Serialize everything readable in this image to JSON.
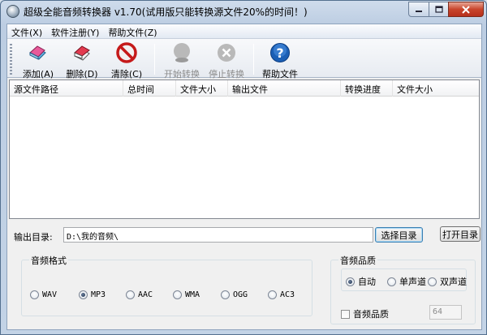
{
  "window": {
    "title": "超级全能音频转换器 v1.70(试用版只能转换源文件20%的时间！)",
    "minimize_icon": "minimize-icon",
    "maximize_icon": "maximize-icon",
    "close_icon": "close-icon"
  },
  "menu": {
    "items": [
      {
        "label": "文件(X)"
      },
      {
        "label": "软件注册(Y)"
      },
      {
        "label": "帮助文件(Z)"
      }
    ]
  },
  "toolbar": {
    "buttons": [
      {
        "label": "添加(A)",
        "icon": "add-files-icon",
        "enabled": true
      },
      {
        "label": "删除(D)",
        "icon": "delete-eraser-icon",
        "enabled": true
      },
      {
        "label": "清除(C)",
        "icon": "clear-forbidden-icon",
        "enabled": true
      },
      {
        "label": "开始转换",
        "icon": "start-convert-icon",
        "enabled": false
      },
      {
        "label": "停止转换",
        "icon": "stop-convert-icon",
        "enabled": false
      },
      {
        "label": "帮助文件",
        "icon": "help-question-icon",
        "enabled": true
      }
    ]
  },
  "file_list": {
    "columns": [
      "源文件路径",
      "总时间",
      "文件大小",
      "输出文件",
      "转换进度",
      "文件大小"
    ],
    "rows": []
  },
  "output": {
    "label": "输出目录:",
    "directory": "D:\\我的音频\\",
    "choose_button": "选择目录",
    "open_button": "打开目录"
  },
  "format": {
    "title": "音频格式",
    "options": [
      "WAV",
      "MP3",
      "AAC",
      "WMA",
      "OGG",
      "AC3"
    ],
    "selected": "MP3"
  },
  "quality": {
    "title": "音频品质",
    "channel_options": [
      "自动",
      "单声道",
      "双声道"
    ],
    "channel_selected": "自动",
    "checkbox_label": "音频品质",
    "checkbox_checked": false,
    "bitrate": "64"
  },
  "colors": {
    "accent": "#3c7fb1",
    "frame": "#54708f",
    "close_button": "#c8452c"
  }
}
